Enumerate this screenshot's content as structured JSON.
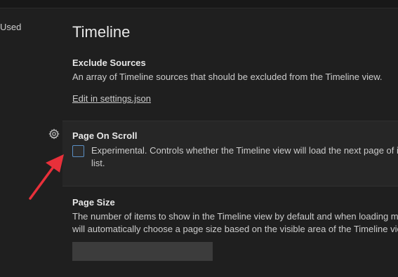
{
  "left_nav": {
    "partial_label": "Used"
  },
  "section": {
    "title": "Timeline"
  },
  "settings": {
    "exclude_sources": {
      "title": "Exclude Sources",
      "description": "An array of Timeline sources that should be excluded from the Timeline view.",
      "link": "Edit in settings.json"
    },
    "page_on_scroll": {
      "title": "Page On Scroll",
      "description_line1": "Experimental. Controls whether the Timeline view will load the next page of i",
      "description_line2": "list.",
      "checked": false
    },
    "page_size": {
      "title": "Page Size",
      "description_line1": "The number of items to show in the Timeline view by default and when loading m",
      "description_line2": "will automatically choose a page size based on the visible area of the Timeline vie",
      "value": ""
    }
  },
  "icons": {
    "gear": "gear-icon",
    "annotation": "red-arrow"
  },
  "colors": {
    "annotation_arrow": "#e8303a",
    "checkbox_border": "#5a8fc4"
  }
}
